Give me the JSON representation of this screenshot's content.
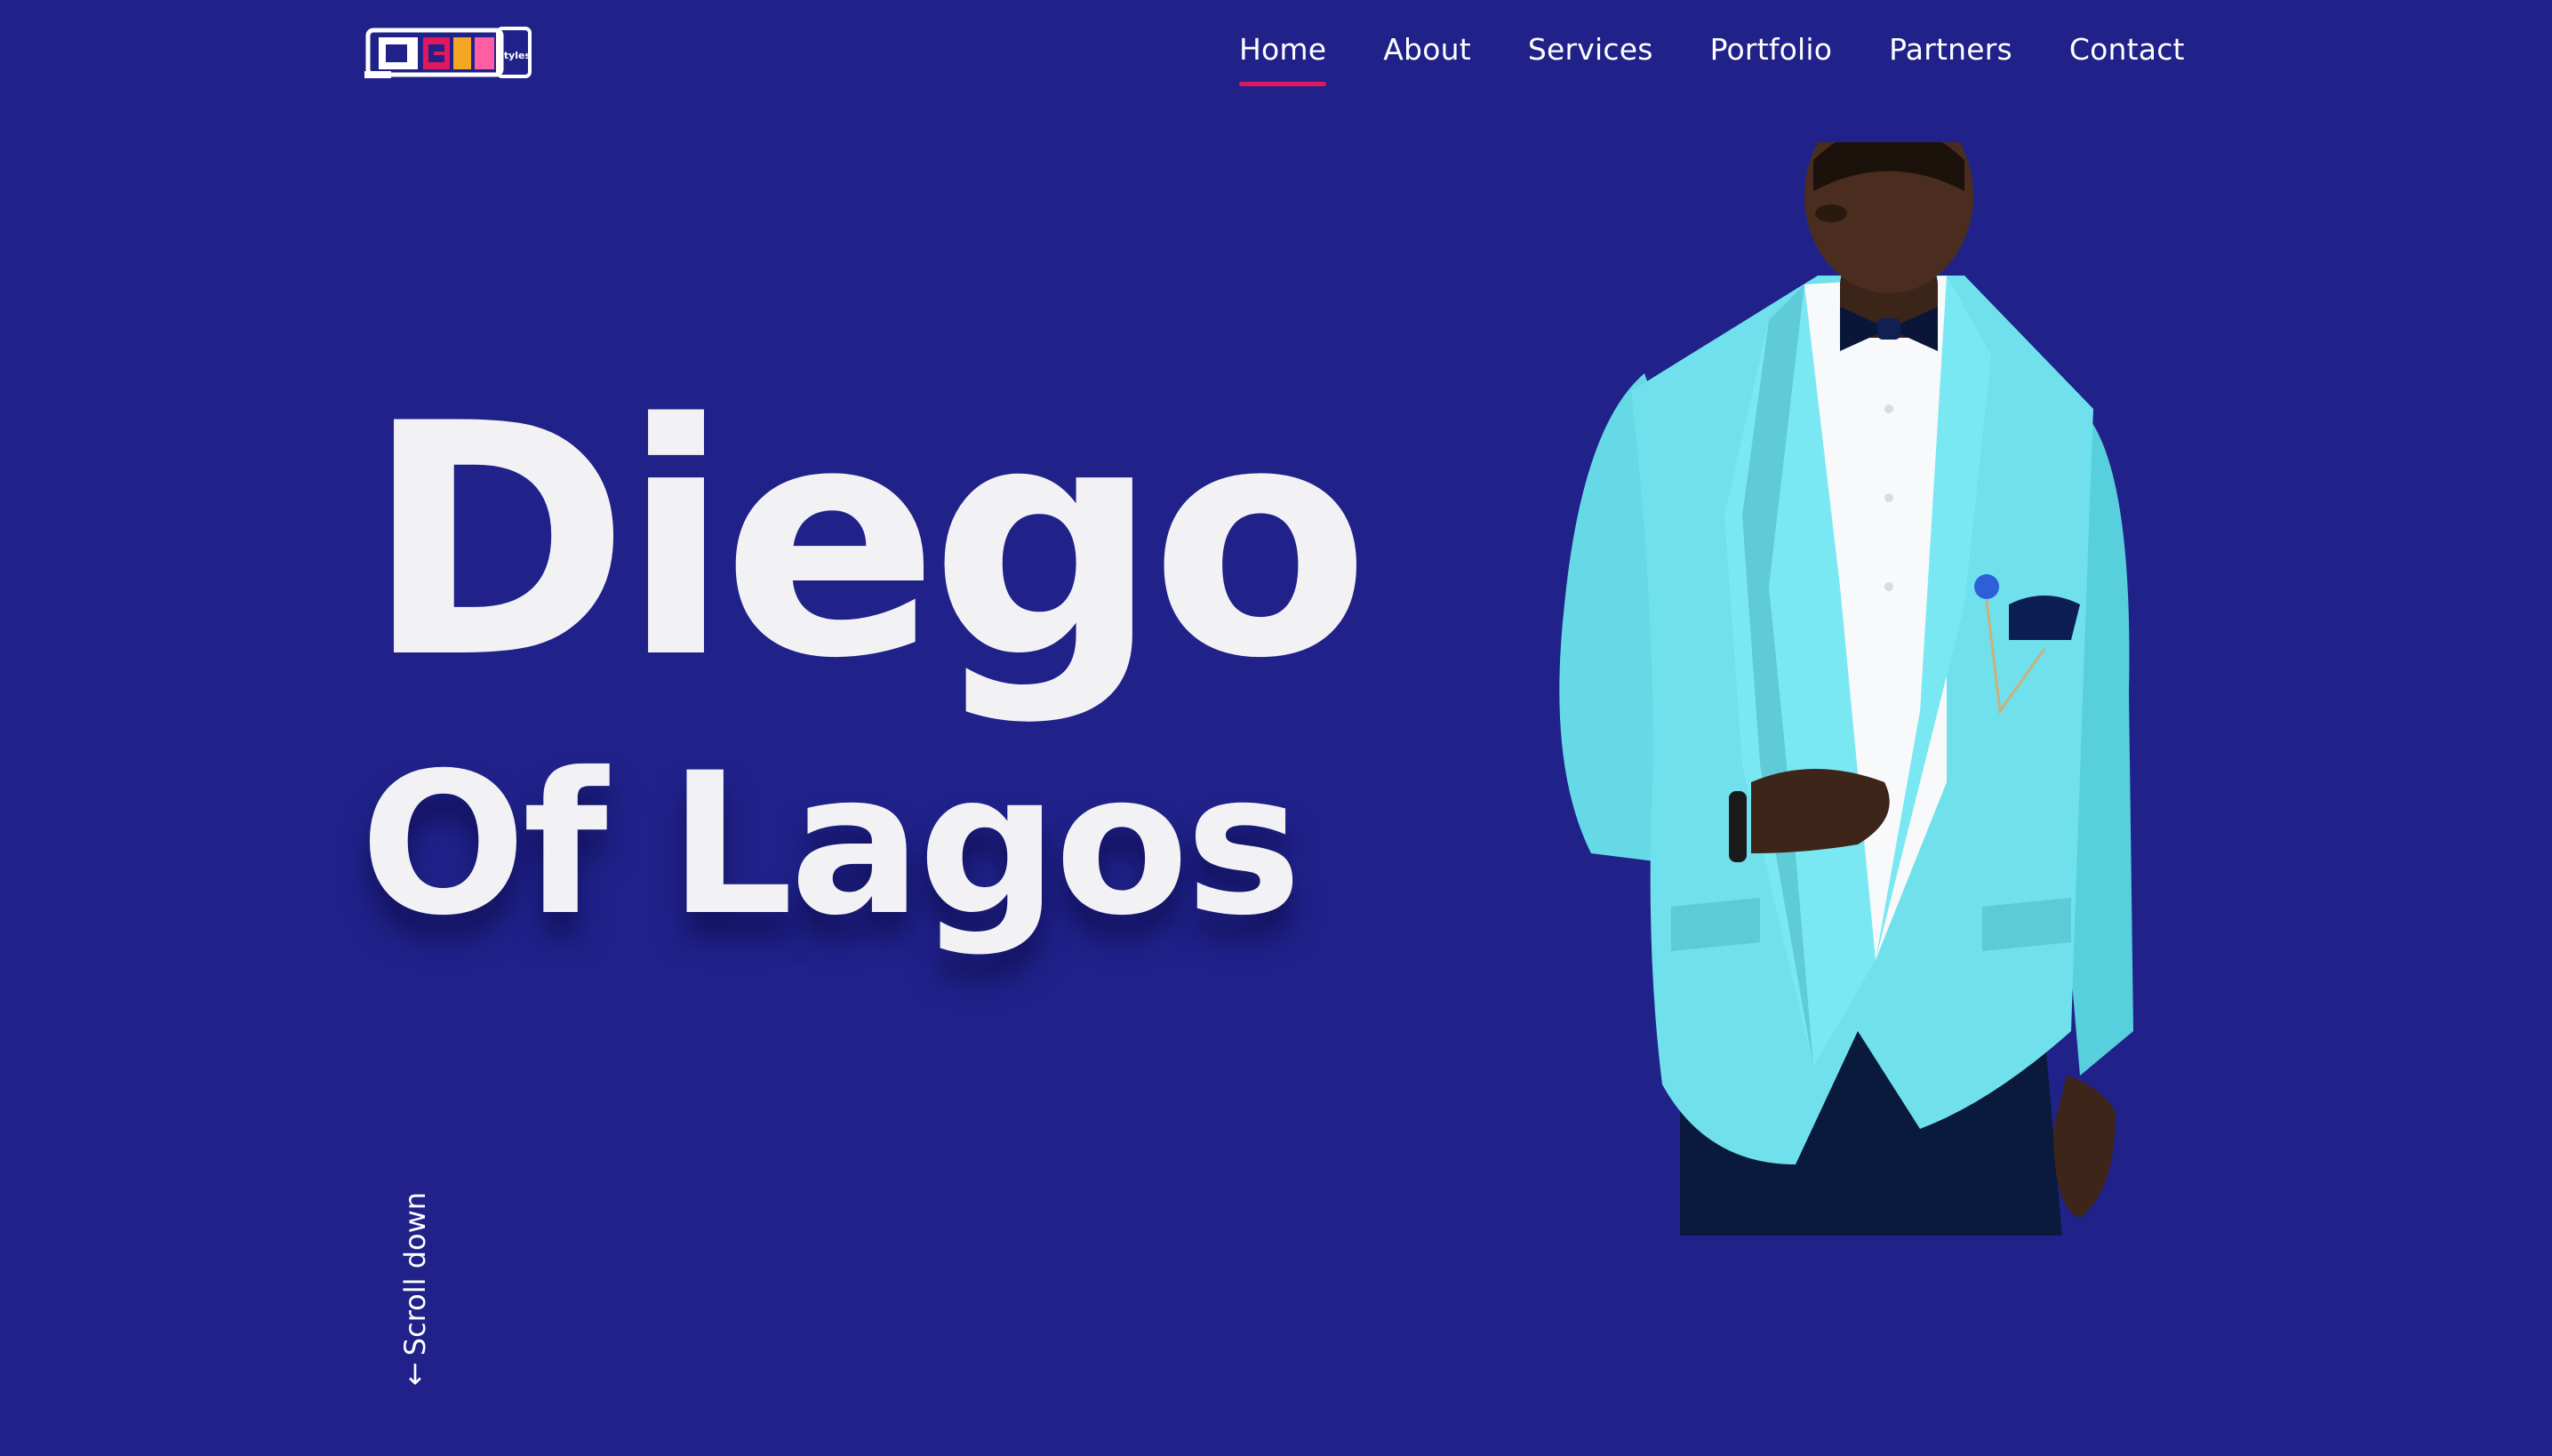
{
  "brand": {
    "logo_icon": "diego-styles-logo",
    "logo_text": "Diego",
    "logo_subtext": "Styles"
  },
  "nav": {
    "items": [
      {
        "label": "Home",
        "active": true
      },
      {
        "label": "About",
        "active": false
      },
      {
        "label": "Services",
        "active": false
      },
      {
        "label": "Portfolio",
        "active": false
      },
      {
        "label": "Partners",
        "active": false
      },
      {
        "label": "Contact",
        "active": false
      }
    ]
  },
  "hero": {
    "title": "Diego",
    "subtitle": "Of Lagos",
    "scroll_label": "Scroll down",
    "scroll_arrow": "↓",
    "image": "model-in-turquoise-tuxedo-photo"
  },
  "colors": {
    "background": "#20228a",
    "accent": "#e0195e",
    "text": "#ffffff",
    "jacket": "#6fe0ec"
  }
}
